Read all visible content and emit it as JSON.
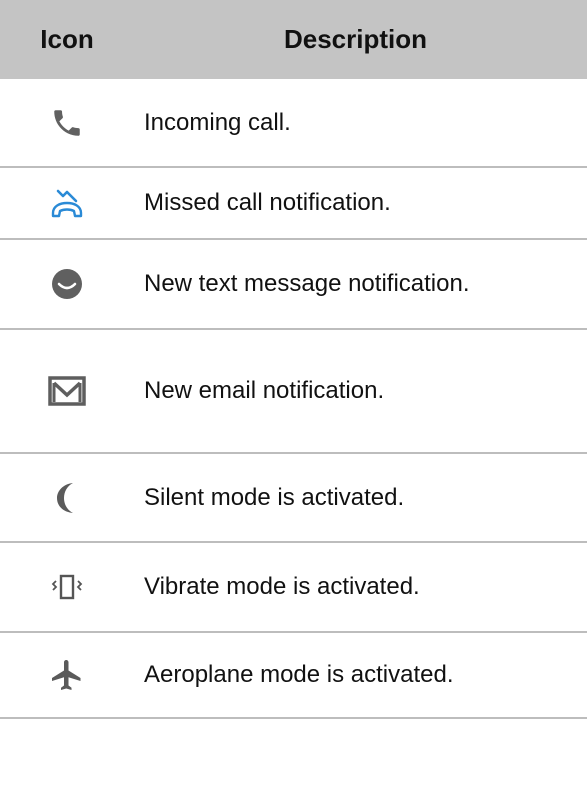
{
  "table": {
    "headers": {
      "icon": "Icon",
      "description": "Description"
    },
    "rows": [
      {
        "icon": "incoming-call-icon",
        "description": "Incoming call."
      },
      {
        "icon": "missed-call-icon",
        "description": "Missed call notification."
      },
      {
        "icon": "text-message-icon",
        "description": "New text message notification."
      },
      {
        "icon": "email-icon",
        "description": "New email notification."
      },
      {
        "icon": "silent-mode-icon",
        "description": "Silent mode is activated."
      },
      {
        "icon": "vibrate-mode-icon",
        "description": "Vibrate mode is activated."
      },
      {
        "icon": "aeroplane-mode-icon",
        "description": "Aeroplane mode is activated."
      }
    ]
  },
  "colors": {
    "header_bg": "#c4c4c4",
    "divider": "#bdbdbd",
    "icon_gray": "#666666",
    "missed_call_blue": "#2a8ad6"
  }
}
